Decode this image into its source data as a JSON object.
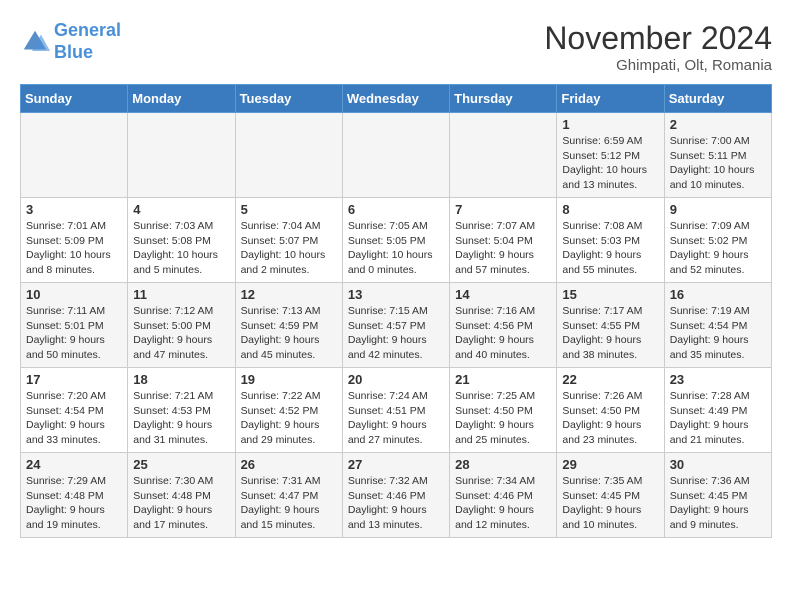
{
  "logo": {
    "line1": "General",
    "line2": "Blue"
  },
  "title": "November 2024",
  "location": "Ghimpati, Olt, Romania",
  "days_header": [
    "Sunday",
    "Monday",
    "Tuesday",
    "Wednesday",
    "Thursday",
    "Friday",
    "Saturday"
  ],
  "weeks": [
    [
      {
        "day": "",
        "info": ""
      },
      {
        "day": "",
        "info": ""
      },
      {
        "day": "",
        "info": ""
      },
      {
        "day": "",
        "info": ""
      },
      {
        "day": "",
        "info": ""
      },
      {
        "day": "1",
        "info": "Sunrise: 6:59 AM\nSunset: 5:12 PM\nDaylight: 10 hours\nand 13 minutes."
      },
      {
        "day": "2",
        "info": "Sunrise: 7:00 AM\nSunset: 5:11 PM\nDaylight: 10 hours\nand 10 minutes."
      }
    ],
    [
      {
        "day": "3",
        "info": "Sunrise: 7:01 AM\nSunset: 5:09 PM\nDaylight: 10 hours\nand 8 minutes."
      },
      {
        "day": "4",
        "info": "Sunrise: 7:03 AM\nSunset: 5:08 PM\nDaylight: 10 hours\nand 5 minutes."
      },
      {
        "day": "5",
        "info": "Sunrise: 7:04 AM\nSunset: 5:07 PM\nDaylight: 10 hours\nand 2 minutes."
      },
      {
        "day": "6",
        "info": "Sunrise: 7:05 AM\nSunset: 5:05 PM\nDaylight: 10 hours\nand 0 minutes."
      },
      {
        "day": "7",
        "info": "Sunrise: 7:07 AM\nSunset: 5:04 PM\nDaylight: 9 hours\nand 57 minutes."
      },
      {
        "day": "8",
        "info": "Sunrise: 7:08 AM\nSunset: 5:03 PM\nDaylight: 9 hours\nand 55 minutes."
      },
      {
        "day": "9",
        "info": "Sunrise: 7:09 AM\nSunset: 5:02 PM\nDaylight: 9 hours\nand 52 minutes."
      }
    ],
    [
      {
        "day": "10",
        "info": "Sunrise: 7:11 AM\nSunset: 5:01 PM\nDaylight: 9 hours\nand 50 minutes."
      },
      {
        "day": "11",
        "info": "Sunrise: 7:12 AM\nSunset: 5:00 PM\nDaylight: 9 hours\nand 47 minutes."
      },
      {
        "day": "12",
        "info": "Sunrise: 7:13 AM\nSunset: 4:59 PM\nDaylight: 9 hours\nand 45 minutes."
      },
      {
        "day": "13",
        "info": "Sunrise: 7:15 AM\nSunset: 4:57 PM\nDaylight: 9 hours\nand 42 minutes."
      },
      {
        "day": "14",
        "info": "Sunrise: 7:16 AM\nSunset: 4:56 PM\nDaylight: 9 hours\nand 40 minutes."
      },
      {
        "day": "15",
        "info": "Sunrise: 7:17 AM\nSunset: 4:55 PM\nDaylight: 9 hours\nand 38 minutes."
      },
      {
        "day": "16",
        "info": "Sunrise: 7:19 AM\nSunset: 4:54 PM\nDaylight: 9 hours\nand 35 minutes."
      }
    ],
    [
      {
        "day": "17",
        "info": "Sunrise: 7:20 AM\nSunset: 4:54 PM\nDaylight: 9 hours\nand 33 minutes."
      },
      {
        "day": "18",
        "info": "Sunrise: 7:21 AM\nSunset: 4:53 PM\nDaylight: 9 hours\nand 31 minutes."
      },
      {
        "day": "19",
        "info": "Sunrise: 7:22 AM\nSunset: 4:52 PM\nDaylight: 9 hours\nand 29 minutes."
      },
      {
        "day": "20",
        "info": "Sunrise: 7:24 AM\nSunset: 4:51 PM\nDaylight: 9 hours\nand 27 minutes."
      },
      {
        "day": "21",
        "info": "Sunrise: 7:25 AM\nSunset: 4:50 PM\nDaylight: 9 hours\nand 25 minutes."
      },
      {
        "day": "22",
        "info": "Sunrise: 7:26 AM\nSunset: 4:50 PM\nDaylight: 9 hours\nand 23 minutes."
      },
      {
        "day": "23",
        "info": "Sunrise: 7:28 AM\nSunset: 4:49 PM\nDaylight: 9 hours\nand 21 minutes."
      }
    ],
    [
      {
        "day": "24",
        "info": "Sunrise: 7:29 AM\nSunset: 4:48 PM\nDaylight: 9 hours\nand 19 minutes."
      },
      {
        "day": "25",
        "info": "Sunrise: 7:30 AM\nSunset: 4:48 PM\nDaylight: 9 hours\nand 17 minutes."
      },
      {
        "day": "26",
        "info": "Sunrise: 7:31 AM\nSunset: 4:47 PM\nDaylight: 9 hours\nand 15 minutes."
      },
      {
        "day": "27",
        "info": "Sunrise: 7:32 AM\nSunset: 4:46 PM\nDaylight: 9 hours\nand 13 minutes."
      },
      {
        "day": "28",
        "info": "Sunrise: 7:34 AM\nSunset: 4:46 PM\nDaylight: 9 hours\nand 12 minutes."
      },
      {
        "day": "29",
        "info": "Sunrise: 7:35 AM\nSunset: 4:45 PM\nDaylight: 9 hours\nand 10 minutes."
      },
      {
        "day": "30",
        "info": "Sunrise: 7:36 AM\nSunset: 4:45 PM\nDaylight: 9 hours\nand 9 minutes."
      }
    ]
  ]
}
